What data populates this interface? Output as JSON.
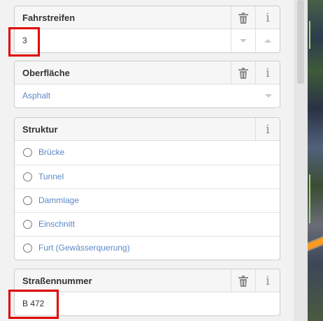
{
  "fields": {
    "fahrstreifen": {
      "label": "Fahrstreifen",
      "value": "3"
    },
    "oberflaeche": {
      "label": "Oberfläche",
      "value": "Asphalt"
    },
    "struktur": {
      "label": "Struktur",
      "options": [
        "Brücke",
        "Tunnel",
        "Dammlage",
        "Einschnitt",
        "Furt (Gewässerquerung)"
      ]
    },
    "strassennummer": {
      "label": "Straßennummer",
      "value": "B 472"
    }
  },
  "icons": {
    "trash": "trash-icon",
    "info": "info-icon",
    "decrement": "triangle-down-icon",
    "increment": "triangle-up-icon",
    "dropdown": "chevron-down-icon"
  },
  "colors": {
    "highlight": "#e00000",
    "link_text": "#5b88c7",
    "road_overlay": "#ff9a20"
  }
}
